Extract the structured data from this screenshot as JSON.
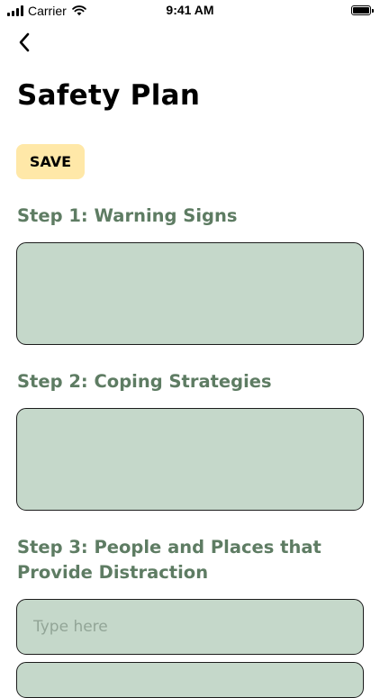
{
  "status_bar": {
    "carrier": "Carrier",
    "time": "9:41 AM"
  },
  "icons": {
    "back": "chevron-left-icon",
    "signal": "cellular-signal-icon",
    "wifi": "wifi-icon",
    "battery": "battery-icon"
  },
  "header": {
    "title": "Safety Plan"
  },
  "save_label": "SAVE",
  "steps": [
    {
      "heading": "Step 1: Warning Signs",
      "value": "",
      "placeholder": ""
    },
    {
      "heading": "Step 2: Coping Strategies",
      "value": "",
      "placeholder": ""
    },
    {
      "heading": "Step 3: People and Places that Provide Distraction",
      "inputs": [
        {
          "value": "",
          "placeholder": "Type here"
        },
        {
          "value": "",
          "placeholder": ""
        }
      ]
    }
  ],
  "colors": {
    "accent_green": "#5e7c63",
    "field_fill": "#c5d8ca",
    "save_fill": "#ffe8a8"
  }
}
